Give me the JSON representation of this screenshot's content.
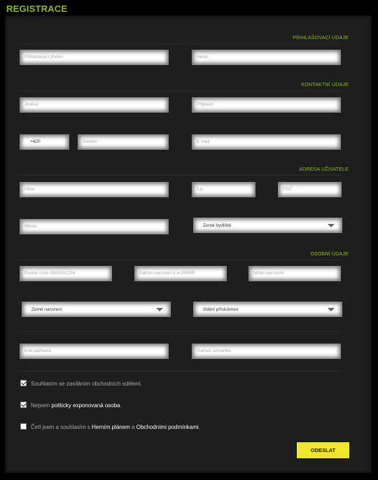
{
  "page": {
    "title": "REGISTRACE"
  },
  "sections": {
    "login": "PŘIHLAŠOVACÍ ÚDAJE",
    "contact": "KONTAKTNÍ ÚDAJE",
    "address": "ADRESA UŽIVATELE",
    "personal": "OSOBNÍ ÚDAJE"
  },
  "fields": {
    "username": {
      "placeholder": "Přihlašovací jméno"
    },
    "password": {
      "placeholder": "Heslo"
    },
    "first_name": {
      "placeholder": "Jméno"
    },
    "last_name": {
      "placeholder": "Příjmení"
    },
    "phone_prefix": {
      "value": "+420"
    },
    "phone": {
      "placeholder": "Telefon"
    },
    "email": {
      "placeholder": "E-mail"
    },
    "street": {
      "placeholder": "Ulice"
    },
    "house_number": {
      "placeholder": "č.p."
    },
    "zip": {
      "placeholder": "PSČ"
    },
    "city": {
      "placeholder": "Město"
    },
    "country_residence": {
      "value": "Země bydliště"
    },
    "birth_number": {
      "placeholder": "Rodné číslo 0000001234"
    },
    "birth_date": {
      "placeholder": "Datum narození d.m.RRRR"
    },
    "birth_place": {
      "placeholder": "Místo narození"
    },
    "country_birth": {
      "value": "Země narození"
    },
    "citizenship": {
      "value": "Státní příslušnost"
    },
    "partner_code": {
      "placeholder": "Kód partnera"
    },
    "data_box": {
      "placeholder": "Datová schránka"
    }
  },
  "consents": {
    "marketing": {
      "checked": true,
      "text": "Souhlasím se zasíláním obchodních sdělení."
    },
    "pep": {
      "checked": true,
      "prefix": "Nejsem ",
      "link": "politicky exponovaná osoba",
      "suffix": "."
    },
    "terms": {
      "checked": false,
      "prefix": "Četl jsem a souhlasím s ",
      "link1": "Herním plánem",
      "middle": " a ",
      "link2": "Obchodními podmínkami",
      "suffix": "."
    }
  },
  "submit_label": "ODESLAT",
  "colors": {
    "accent": "#8cbe1e",
    "button": "#f0e62a",
    "panel": "#1e1e1e"
  }
}
